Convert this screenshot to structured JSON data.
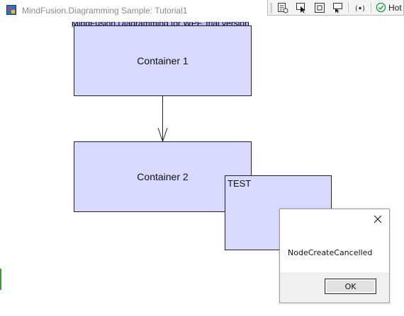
{
  "window": {
    "title": "MindFusion.Diagramming Sample: Tutorial1",
    "top_fragment": "..."
  },
  "toolbar": {
    "buttons": [
      {
        "name": "property-grid-icon"
      },
      {
        "name": "select-element-icon"
      },
      {
        "name": "layout-adorner-icon"
      },
      {
        "name": "track-focus-icon"
      },
      {
        "name": "binding-icon"
      }
    ],
    "hot_reload_label": "Hot",
    "hot_reload_status_color": "#1e9e3e"
  },
  "diagram": {
    "trial_banner": "MindFusion.Diagramming for WPF, trial version",
    "nodes": [
      {
        "id": "container-1",
        "text": "Container 1"
      },
      {
        "id": "container-2",
        "text": "Container 2"
      },
      {
        "id": "test",
        "text": "TEST"
      }
    ],
    "node_fill": "#d9d9ff",
    "node_stroke": "#222222"
  },
  "message_box": {
    "message": "NodeCreateCancelled",
    "ok_label": "OK"
  }
}
